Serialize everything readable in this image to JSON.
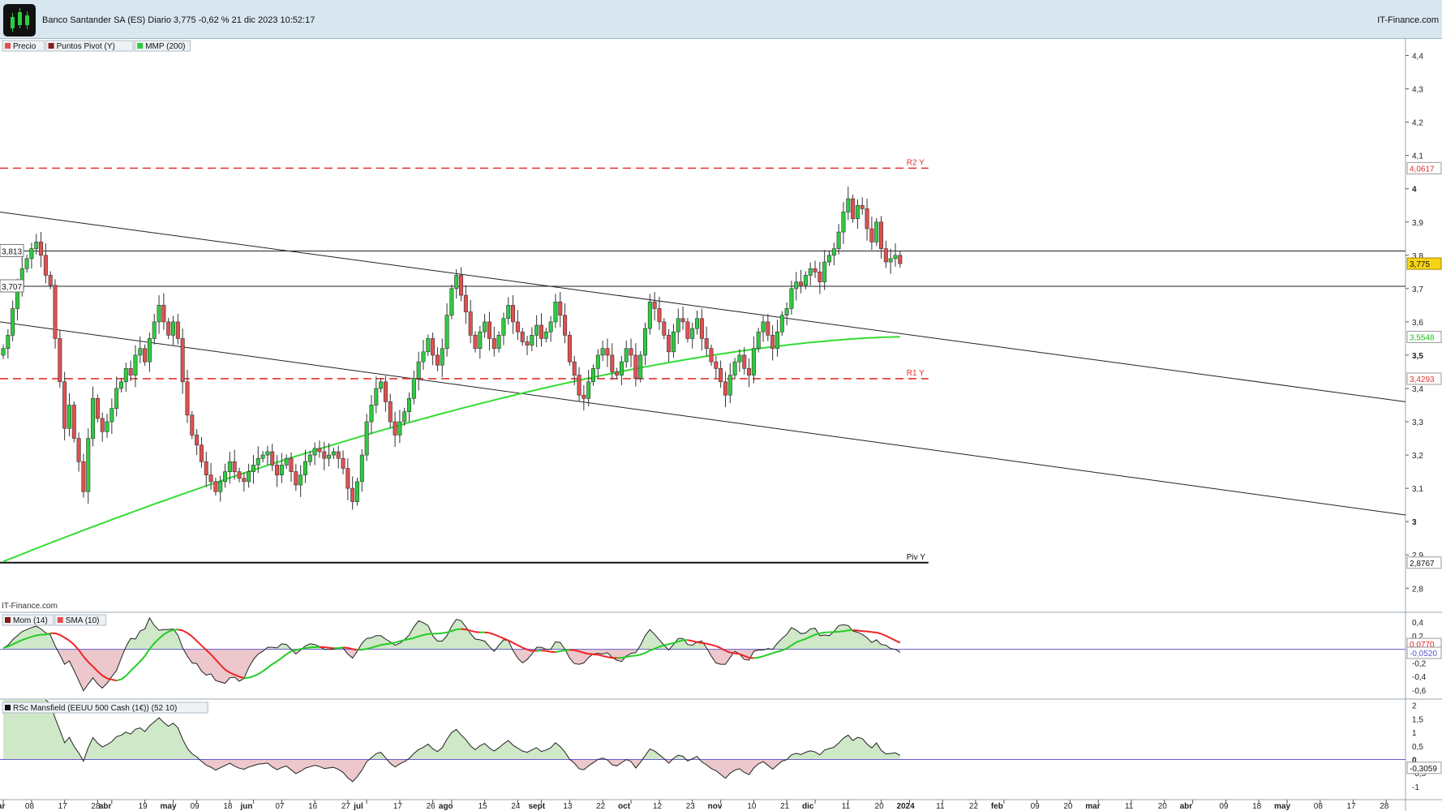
{
  "header": {
    "title": "Banco Santander SA (ES) Diario 3,775 -0,62 % 21 dic 2023 10:52:17",
    "brand": "IT-Finance.com"
  },
  "colors": {
    "up": "#2ecc40",
    "down": "#e05050",
    "sma200": "#33dd33",
    "pivot": "#e53030",
    "momentum_line": "#222222",
    "momentum_signal": "#ee2222",
    "momentum_signal2": "#22cc22",
    "panel_zero": "#6a5acd"
  },
  "legend": {
    "price": [
      "Precio",
      "Puntos Pivot (Y)",
      "MMP (200)"
    ],
    "momentum": [
      "Mom (14)",
      "SMA (10)"
    ],
    "rsc": [
      "RSc Mansfield (EEUU 500 Cash (1€)) (52 10)"
    ]
  },
  "watermark": "IT-Finance.com",
  "chart_data": [
    {
      "type": "candlestick",
      "name": "Precio",
      "y_ticks": [
        "2,8",
        "2,9",
        "3",
        "3,1",
        "3,2",
        "3,3",
        "3,4",
        "3,5",
        "3,6",
        "3,7",
        "3,8",
        "3,9",
        "4",
        "4,1",
        "4,2",
        "4,3",
        "4,4"
      ],
      "y_tick_values": [
        2.8,
        2.9,
        3.0,
        3.1,
        3.2,
        3.3,
        3.4,
        3.5,
        3.6,
        3.7,
        3.8,
        3.9,
        4.0,
        4.1,
        4.2,
        4.3,
        4.4
      ],
      "ylim": [
        2.73,
        4.45
      ],
      "x_ticks": [
        "mar",
        "08",
        "17",
        "28",
        "abr",
        "19",
        "may",
        "09",
        "18",
        "jun",
        "07",
        "16",
        "27",
        "jul",
        "17",
        "26",
        "ago",
        "15",
        "24",
        "sept",
        "13",
        "22",
        "oct",
        "12",
        "23",
        "nov",
        "10",
        "21",
        "dic",
        "11",
        "20",
        "2024",
        "11",
        "22",
        "feb",
        "09",
        "20",
        "mar",
        "11",
        "20",
        "abr",
        "09",
        "18",
        "may",
        "08",
        "17",
        "28"
      ],
      "x_tick_index": [
        0,
        6,
        13,
        20,
        23,
        30,
        36,
        41,
        48,
        53,
        59,
        66,
        73,
        77,
        84,
        91,
        95,
        102,
        109,
        114,
        120,
        127,
        133,
        139,
        146,
        152,
        159,
        166,
        172,
        179,
        186,
        192,
        199,
        206,
        212,
        219,
        226,
        232,
        239,
        246,
        252,
        259,
        266,
        272,
        279,
        286,
        293
      ],
      "price_start": 3.5,
      "closes": [
        3.52,
        3.56,
        3.64,
        3.7,
        3.76,
        3.79,
        3.82,
        3.84,
        3.8,
        3.74,
        3.71,
        3.55,
        3.42,
        3.28,
        3.35,
        3.25,
        3.18,
        3.09,
        3.25,
        3.37,
        3.31,
        3.27,
        3.3,
        3.34,
        3.4,
        3.42,
        3.46,
        3.44,
        3.5,
        3.52,
        3.48,
        3.55,
        3.6,
        3.65,
        3.6,
        3.56,
        3.6,
        3.55,
        3.42,
        3.32,
        3.26,
        3.23,
        3.18,
        3.14,
        3.12,
        3.09,
        3.12,
        3.15,
        3.18,
        3.15,
        3.13,
        3.12,
        3.15,
        3.17,
        3.19,
        3.2,
        3.21,
        3.17,
        3.14,
        3.17,
        3.19,
        3.15,
        3.11,
        3.14,
        3.18,
        3.2,
        3.22,
        3.21,
        3.19,
        3.2,
        3.21,
        3.19,
        3.16,
        3.1,
        3.06,
        3.12,
        3.2,
        3.3,
        3.35,
        3.4,
        3.42,
        3.36,
        3.3,
        3.26,
        3.3,
        3.33,
        3.37,
        3.43,
        3.48,
        3.51,
        3.55,
        3.5,
        3.47,
        3.52,
        3.62,
        3.7,
        3.74,
        3.68,
        3.63,
        3.56,
        3.52,
        3.57,
        3.6,
        3.55,
        3.52,
        3.56,
        3.61,
        3.65,
        3.6,
        3.57,
        3.54,
        3.53,
        3.56,
        3.59,
        3.55,
        3.57,
        3.6,
        3.66,
        3.62,
        3.56,
        3.48,
        3.44,
        3.38,
        3.37,
        3.42,
        3.46,
        3.5,
        3.52,
        3.5,
        3.45,
        3.44,
        3.48,
        3.52,
        3.5,
        3.43,
        3.5,
        3.58,
        3.66,
        3.64,
        3.6,
        3.56,
        3.51,
        3.57,
        3.61,
        3.6,
        3.55,
        3.58,
        3.61,
        3.55,
        3.52,
        3.48,
        3.46,
        3.42,
        3.38,
        3.44,
        3.48,
        3.5,
        3.46,
        3.44,
        3.52,
        3.57,
        3.6,
        3.56,
        3.52,
        3.57,
        3.62,
        3.64,
        3.7,
        3.72,
        3.71,
        3.74,
        3.76,
        3.75,
        3.72,
        3.78,
        3.8,
        3.82,
        3.87,
        3.93,
        3.97,
        3.91,
        3.95,
        3.94,
        3.88,
        3.84,
        3.9,
        3.82,
        3.78,
        3.79,
        3.8,
        3.775
      ],
      "series": [
        {
          "name": "MMP (200)",
          "value_start": 2.88,
          "value_end": 3.555
        },
        {
          "name": "Puntos Pivot (Y)",
          "levels": [
            {
              "label": "R2 Y",
              "value": 4.0617,
              "tag": "4,0617"
            },
            {
              "label": "R1 Y",
              "value": 3.4293,
              "tag": "3,4293"
            },
            {
              "label": "Piv Y",
              "value": 2.8767,
              "tag": "2,8767"
            }
          ]
        }
      ],
      "horizontal_lines": [
        {
          "value": 3.813,
          "label": "3,813"
        },
        {
          "value": 3.707,
          "label": "3,707"
        }
      ],
      "last_price": {
        "value": 3.775,
        "label": "3,775"
      },
      "ma_tag": {
        "value": 3.5548,
        "label": "3,5548"
      }
    },
    {
      "type": "line",
      "name": "Mom (14)",
      "y_ticks": [
        "0,4",
        "0,2",
        "0",
        "-0,2",
        "-0,4",
        "-0,6"
      ],
      "y_tick_values": [
        0.4,
        0.2,
        0,
        -0.2,
        -0.4,
        -0.6
      ],
      "ylim": [
        -0.72,
        0.52
      ],
      "tags": [
        {
          "value": 0.077,
          "label": "0,0770"
        },
        {
          "value": -0.052,
          "label": "-0,0520"
        }
      ]
    },
    {
      "type": "area",
      "name": "RSc Mansfield (EEUU 500 Cash (1€)) (52 10)",
      "y_ticks": [
        "2",
        "1,5",
        "1",
        "0,5",
        "0",
        "-0,5",
        "-1"
      ],
      "y_tick_values": [
        2,
        1.5,
        1,
        0.5,
        0,
        -0.5,
        -1
      ],
      "ylim": [
        -1.45,
        2.2
      ],
      "tags": [
        {
          "value": -0.3059,
          "label": "-0,3059"
        }
      ]
    }
  ]
}
